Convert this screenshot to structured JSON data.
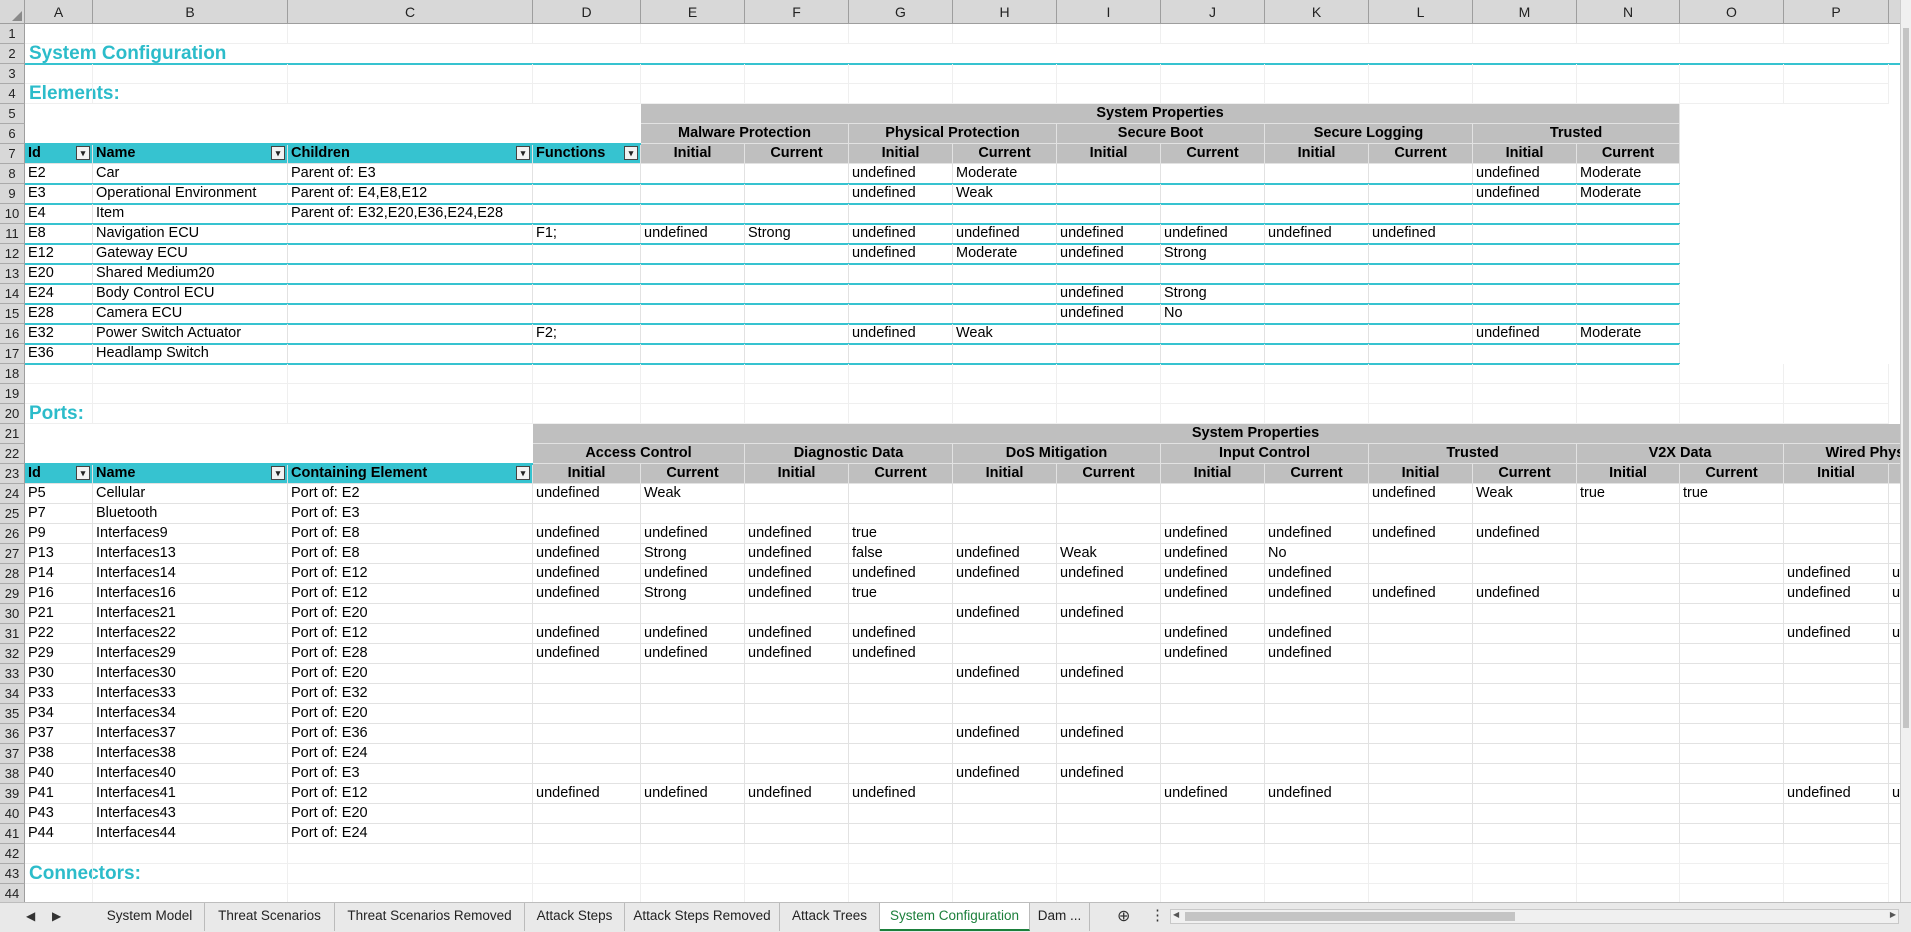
{
  "columns": [
    "A",
    "B",
    "C",
    "D",
    "E",
    "F",
    "G",
    "H",
    "I",
    "J",
    "K",
    "L",
    "M",
    "N",
    "O",
    "P"
  ],
  "rows": [
    "1",
    "2",
    "3",
    "4",
    "5",
    "6",
    "7",
    "8",
    "9",
    "10",
    "11",
    "12",
    "13",
    "14",
    "15",
    "16",
    "17",
    "18",
    "19",
    "20",
    "21",
    "22",
    "23",
    "24",
    "25",
    "26",
    "27",
    "28",
    "29",
    "30",
    "31",
    "32",
    "33",
    "34",
    "35",
    "36",
    "37",
    "38",
    "39",
    "40",
    "41",
    "42",
    "43",
    "44"
  ],
  "titles": {
    "system_configuration": "System Configuration",
    "elements": "Elements:",
    "ports": "Ports:",
    "connectors": "Connectors:"
  },
  "elements": {
    "system_properties": "System Properties",
    "groups": [
      "Malware Protection",
      "Physical Protection",
      "Secure Boot",
      "Secure Logging",
      "Trusted"
    ],
    "initial": "Initial",
    "current": "Current",
    "headers": [
      "Id",
      "Name",
      "Children",
      "Functions"
    ],
    "rows": [
      [
        "E2",
        "Car",
        "Parent of: E3",
        "",
        "",
        "",
        "undefined",
        "Moderate",
        "",
        "",
        "",
        "",
        "undefined",
        "Moderate"
      ],
      [
        "E3",
        "Operational Environment",
        "Parent of: E4,E8,E12",
        "",
        "",
        "",
        "undefined",
        "Weak",
        "",
        "",
        "",
        "",
        "undefined",
        "Moderate"
      ],
      [
        "E4",
        "Item",
        "Parent of: E32,E20,E36,E24,E28",
        "",
        "",
        "",
        "",
        "",
        "",
        "",
        "",
        "",
        "",
        ""
      ],
      [
        "E8",
        "Navigation ECU",
        "",
        "F1;",
        "undefined",
        "Strong",
        "undefined",
        "undefined",
        "undefined",
        "undefined",
        "undefined",
        "undefined",
        "",
        ""
      ],
      [
        "E12",
        "Gateway ECU",
        "",
        "",
        "",
        "",
        "undefined",
        "Moderate",
        "undefined",
        "Strong",
        "",
        "",
        "",
        ""
      ],
      [
        "E20",
        "Shared Medium20",
        "",
        "",
        "",
        "",
        "",
        "",
        "",
        "",
        "",
        "",
        "",
        ""
      ],
      [
        "E24",
        "Body Control ECU",
        "",
        "",
        "",
        "",
        "",
        "",
        "undefined",
        "Strong",
        "",
        "",
        "",
        ""
      ],
      [
        "E28",
        "Camera ECU",
        "",
        "",
        "",
        "",
        "",
        "",
        "undefined",
        "No",
        "",
        "",
        "",
        ""
      ],
      [
        "E32",
        "Power Switch Actuator",
        "",
        "F2;",
        "",
        "",
        "undefined",
        "Weak",
        "",
        "",
        "",
        "",
        "undefined",
        "Moderate"
      ],
      [
        "E36",
        "Headlamp Switch",
        "",
        "",
        "",
        "",
        "",
        "",
        "",
        "",
        "",
        "",
        "",
        ""
      ]
    ]
  },
  "ports": {
    "system_properties": "System Properties",
    "groups": [
      "Access Control",
      "Diagnostic Data",
      "DoS Mitigation",
      "Input Control",
      "Trusted",
      "V2X Data",
      "Wired Physical I"
    ],
    "initial": "Initial",
    "current": "Current",
    "partial_current": "Cu",
    "headers": [
      "Id",
      "Name",
      "Containing Element"
    ],
    "rows": [
      [
        "P5",
        "Cellular",
        "Port of: E2",
        "undefined",
        "Weak",
        "",
        "",
        "",
        "",
        "",
        "",
        "undefined",
        "Weak",
        "true",
        "true",
        "",
        ""
      ],
      [
        "P7",
        "Bluetooth",
        "Port of: E3",
        "",
        "",
        "",
        "",
        "",
        "",
        "",
        "",
        "",
        "",
        "",
        "",
        "",
        ""
      ],
      [
        "P9",
        "Interfaces9",
        "Port of: E8",
        "undefined",
        "undefined",
        "undefined",
        "true",
        "",
        "",
        "undefined",
        "undefined",
        "undefined",
        "undefined",
        "",
        "",
        "",
        ""
      ],
      [
        "P13",
        "Interfaces13",
        "Port of: E8",
        "undefined",
        "Strong",
        "undefined",
        "false",
        "undefined",
        "Weak",
        "undefined",
        "No",
        "",
        "",
        "",
        "",
        "",
        ""
      ],
      [
        "P14",
        "Interfaces14",
        "Port of: E12",
        "undefined",
        "undefined",
        "undefined",
        "undefined",
        "undefined",
        "undefined",
        "undefined",
        "undefined",
        "",
        "",
        "",
        "",
        "undefined",
        "undefi"
      ],
      [
        "P16",
        "Interfaces16",
        "Port of: E12",
        "undefined",
        "Strong",
        "undefined",
        "true",
        "",
        "",
        "undefined",
        "undefined",
        "undefined",
        "undefined",
        "",
        "",
        "undefined",
        "undefi"
      ],
      [
        "P21",
        "Interfaces21",
        "Port of: E20",
        "",
        "",
        "",
        "",
        "undefined",
        "undefined",
        "",
        "",
        "",
        "",
        "",
        "",
        "",
        ""
      ],
      [
        "P22",
        "Interfaces22",
        "Port of: E12",
        "undefined",
        "undefined",
        "undefined",
        "undefined",
        "",
        "",
        "undefined",
        "undefined",
        "",
        "",
        "",
        "",
        "undefined",
        "undefi"
      ],
      [
        "P29",
        "Interfaces29",
        "Port of: E28",
        "undefined",
        "undefined",
        "undefined",
        "undefined",
        "",
        "",
        "undefined",
        "undefined",
        "",
        "",
        "",
        "",
        "",
        ""
      ],
      [
        "P30",
        "Interfaces30",
        "Port of: E20",
        "",
        "",
        "",
        "",
        "undefined",
        "undefined",
        "",
        "",
        "",
        "",
        "",
        "",
        "",
        ""
      ],
      [
        "P33",
        "Interfaces33",
        "Port of: E32",
        "",
        "",
        "",
        "",
        "",
        "",
        "",
        "",
        "",
        "",
        "",
        "",
        "",
        ""
      ],
      [
        "P34",
        "Interfaces34",
        "Port of: E20",
        "",
        "",
        "",
        "",
        "",
        "",
        "",
        "",
        "",
        "",
        "",
        "",
        "",
        ""
      ],
      [
        "P37",
        "Interfaces37",
        "Port of: E36",
        "",
        "",
        "",
        "",
        "undefined",
        "undefined",
        "",
        "",
        "",
        "",
        "",
        "",
        "",
        ""
      ],
      [
        "P38",
        "Interfaces38",
        "Port of: E24",
        "",
        "",
        "",
        "",
        "",
        "",
        "",
        "",
        "",
        "",
        "",
        "",
        "",
        ""
      ],
      [
        "P40",
        "Interfaces40",
        "Port of: E3",
        "",
        "",
        "",
        "",
        "undefined",
        "undefined",
        "",
        "",
        "",
        "",
        "",
        "",
        "",
        ""
      ],
      [
        "P41",
        "Interfaces41",
        "Port of: E12",
        "undefined",
        "undefined",
        "undefined",
        "undefined",
        "",
        "",
        "undefined",
        "undefined",
        "",
        "",
        "",
        "",
        "undefined",
        "undefi"
      ],
      [
        "P43",
        "Interfaces43",
        "Port of: E20",
        "",
        "",
        "",
        "",
        "",
        "",
        "",
        "",
        "",
        "",
        "",
        "",
        "",
        ""
      ],
      [
        "P44",
        "Interfaces44",
        "Port of: E24",
        "",
        "",
        "",
        "",
        "",
        "",
        "",
        "",
        "",
        "",
        "",
        "",
        "",
        ""
      ]
    ]
  },
  "tabs": {
    "items": [
      "System Model",
      "Threat Scenarios",
      "Threat Scenarios Removed",
      "Attack Steps",
      "Attack Steps Removed",
      "Attack Trees",
      "System Configuration",
      "Dam ..."
    ],
    "active": "System Configuration",
    "add_symbol": "⊕",
    "more_symbol": "⋮",
    "prev_symbol": "◀",
    "next_symbol": "▶"
  },
  "colors": {
    "accent": "#36c3d0",
    "title": "#2cbcca",
    "group_header": "#bfbfbf",
    "active_tab": "#1b7f3b"
  }
}
